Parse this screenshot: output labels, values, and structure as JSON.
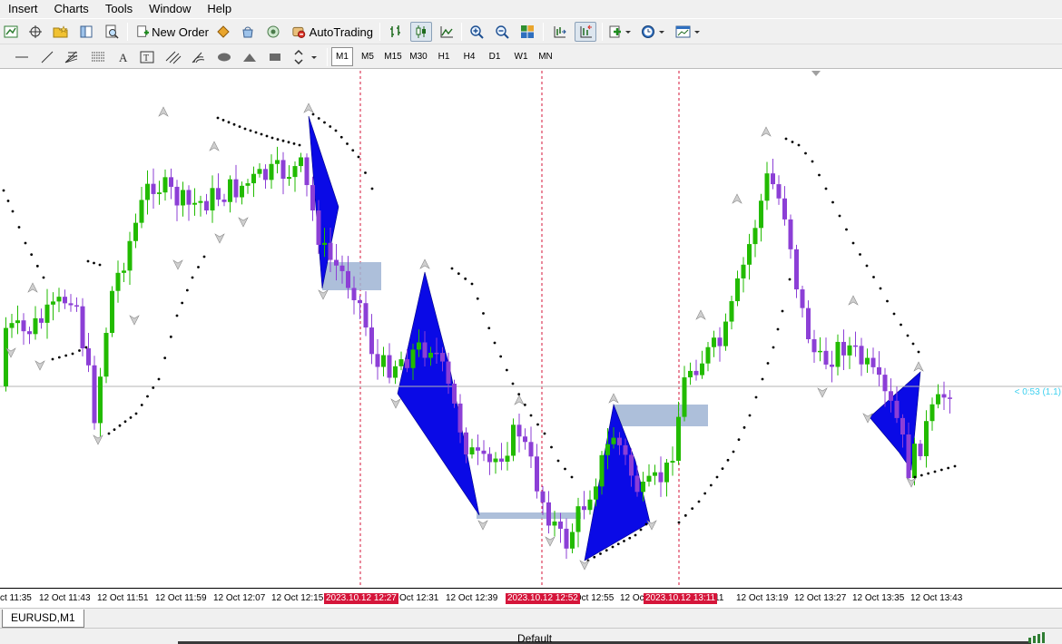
{
  "menu": [
    "Insert",
    "Charts",
    "Tools",
    "Window",
    "Help"
  ],
  "toolbar": {
    "new_order_label": "New Order",
    "autotrading_label": "AutoTrading"
  },
  "timeframes": [
    "M1",
    "M5",
    "M15",
    "M30",
    "H1",
    "H4",
    "D1",
    "W1",
    "MN"
  ],
  "active_timeframe": "M1",
  "chart": {
    "price_marker": "< 0:53 (1.1)",
    "time_labels": [
      "ct 11:35",
      "12 Oct 11:43",
      "12 Oct 11:51",
      "12 Oct 11:59",
      "12 Oct 12:07",
      "12 Oct 12:15",
      "Oct 12:31",
      "12 Oct 12:39",
      "12 Oct 12:55",
      "12 Oc",
      "11",
      "12 Oct 13:19",
      "12 Oct 13:27",
      "12 Oct 13:35",
      "12 Oct 13:43"
    ],
    "separator_labels": [
      "2023.10.12 12:27",
      "2023.10.12 12:52",
      "2023.10.12 13:11"
    ],
    "colors": {
      "bull": "#22bb00",
      "bear": "#8c3fd6",
      "pattern": "#0a0ae6",
      "zone": "#9fb4d4",
      "separator": "#d5153a",
      "price_line": "#b4b4b4",
      "price_text": "#3dd0ef"
    }
  },
  "tabs": [
    "EURUSD,M1"
  ],
  "status": {
    "profile": "Default"
  }
}
